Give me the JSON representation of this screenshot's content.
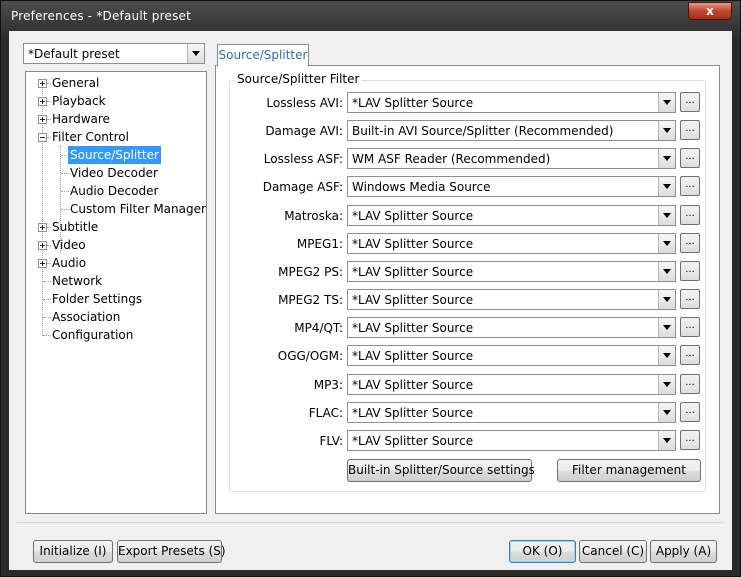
{
  "window": {
    "title": "Preferences - *Default preset",
    "close_glyph": "x"
  },
  "preset": {
    "value": "*Default preset"
  },
  "tree": {
    "items": [
      {
        "label": "General"
      },
      {
        "label": "Playback"
      },
      {
        "label": "Hardware"
      },
      {
        "label": "Filter Control"
      },
      {
        "label": "Source/Splitter"
      },
      {
        "label": "Video Decoder"
      },
      {
        "label": "Audio Decoder"
      },
      {
        "label": "Custom Filter Manager"
      },
      {
        "label": "Subtitle"
      },
      {
        "label": "Video"
      },
      {
        "label": "Audio"
      },
      {
        "label": "Network"
      },
      {
        "label": "Folder Settings"
      },
      {
        "label": "Association"
      },
      {
        "label": "Configuration"
      }
    ]
  },
  "tab": {
    "label": "Source/Splitter"
  },
  "group": {
    "title": "Source/Splitter Filter"
  },
  "filters": [
    {
      "label": "Lossless AVI:",
      "value": "*LAV Splitter Source"
    },
    {
      "label": "Damage AVI:",
      "value": "Built-in AVI Source/Splitter (Recommended)"
    },
    {
      "label": "Lossless ASF:",
      "value": "WM ASF Reader (Recommended)"
    },
    {
      "label": "Damage ASF:",
      "value": "Windows Media Source"
    },
    {
      "label": "Matroska:",
      "value": "*LAV Splitter Source"
    },
    {
      "label": "MPEG1:",
      "value": "*LAV Splitter Source"
    },
    {
      "label": "MPEG2 PS:",
      "value": "*LAV Splitter Source"
    },
    {
      "label": "MPEG2 TS:",
      "value": "*LAV Splitter Source"
    },
    {
      "label": "MP4/QT:",
      "value": "*LAV Splitter Source"
    },
    {
      "label": "OGG/OGM:",
      "value": "*LAV Splitter Source"
    },
    {
      "label": "MP3:",
      "value": "*LAV Splitter Source"
    },
    {
      "label": "FLAC:",
      "value": "*LAV Splitter Source"
    },
    {
      "label": "FLV:",
      "value": "*LAV Splitter Source"
    }
  ],
  "more_button_label": "...",
  "panel_buttons": {
    "builtin_settings": "Built-in Splitter/Source settings",
    "filter_management": "Filter management"
  },
  "footer": {
    "initialize": "Initialize (I)",
    "export_presets": "Export Presets (S)",
    "ok": "OK (O)",
    "cancel": "Cancel (C)",
    "apply": "Apply (A)"
  }
}
